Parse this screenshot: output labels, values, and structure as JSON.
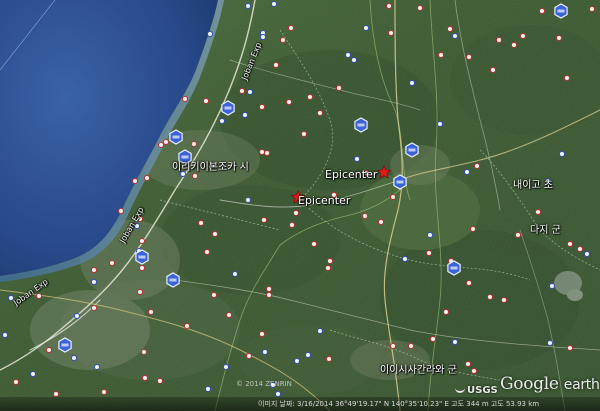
{
  "app": {
    "name": "Google earth"
  },
  "labels": {
    "epicenter_a": "Epicenter",
    "epicenter_b": "Epicenter",
    "city_west": "이리키이본조카 시",
    "town_east": "내이고 초",
    "county_east": "다지 군",
    "district_south": "이이시사간라와 군",
    "road_n": "Joban Exp",
    "road_w": "Joban Exp",
    "road_sw": "Joban Exp"
  },
  "attribution": {
    "usgs": "USGS",
    "google_earth_1": "Google",
    "google_earth_2": "earth",
    "copyright": "© 2014 ZENRIN",
    "status": "이미지 날짜: 3/16/2014   36°49'19.17\" N 140°35'10.23\" E 고도 344 m   고도 53.93 km"
  },
  "colors": {
    "ocean": "#2c4f8a",
    "land": "#3b5a34",
    "star": "#e11a1a",
    "shield": "#3b62d6"
  },
  "shields": [
    {
      "name": "route-shield",
      "text": ""
    },
    {
      "name": "route-shield",
      "text": ""
    },
    {
      "name": "route-shield",
      "text": ""
    },
    {
      "name": "route-shield",
      "text": ""
    },
    {
      "name": "route-shield",
      "text": ""
    },
    {
      "name": "route-shield",
      "text": ""
    },
    {
      "name": "route-shield",
      "text": ""
    },
    {
      "name": "route-shield",
      "text": ""
    },
    {
      "name": "route-shield",
      "text": ""
    },
    {
      "name": "route-shield",
      "text": ""
    }
  ]
}
